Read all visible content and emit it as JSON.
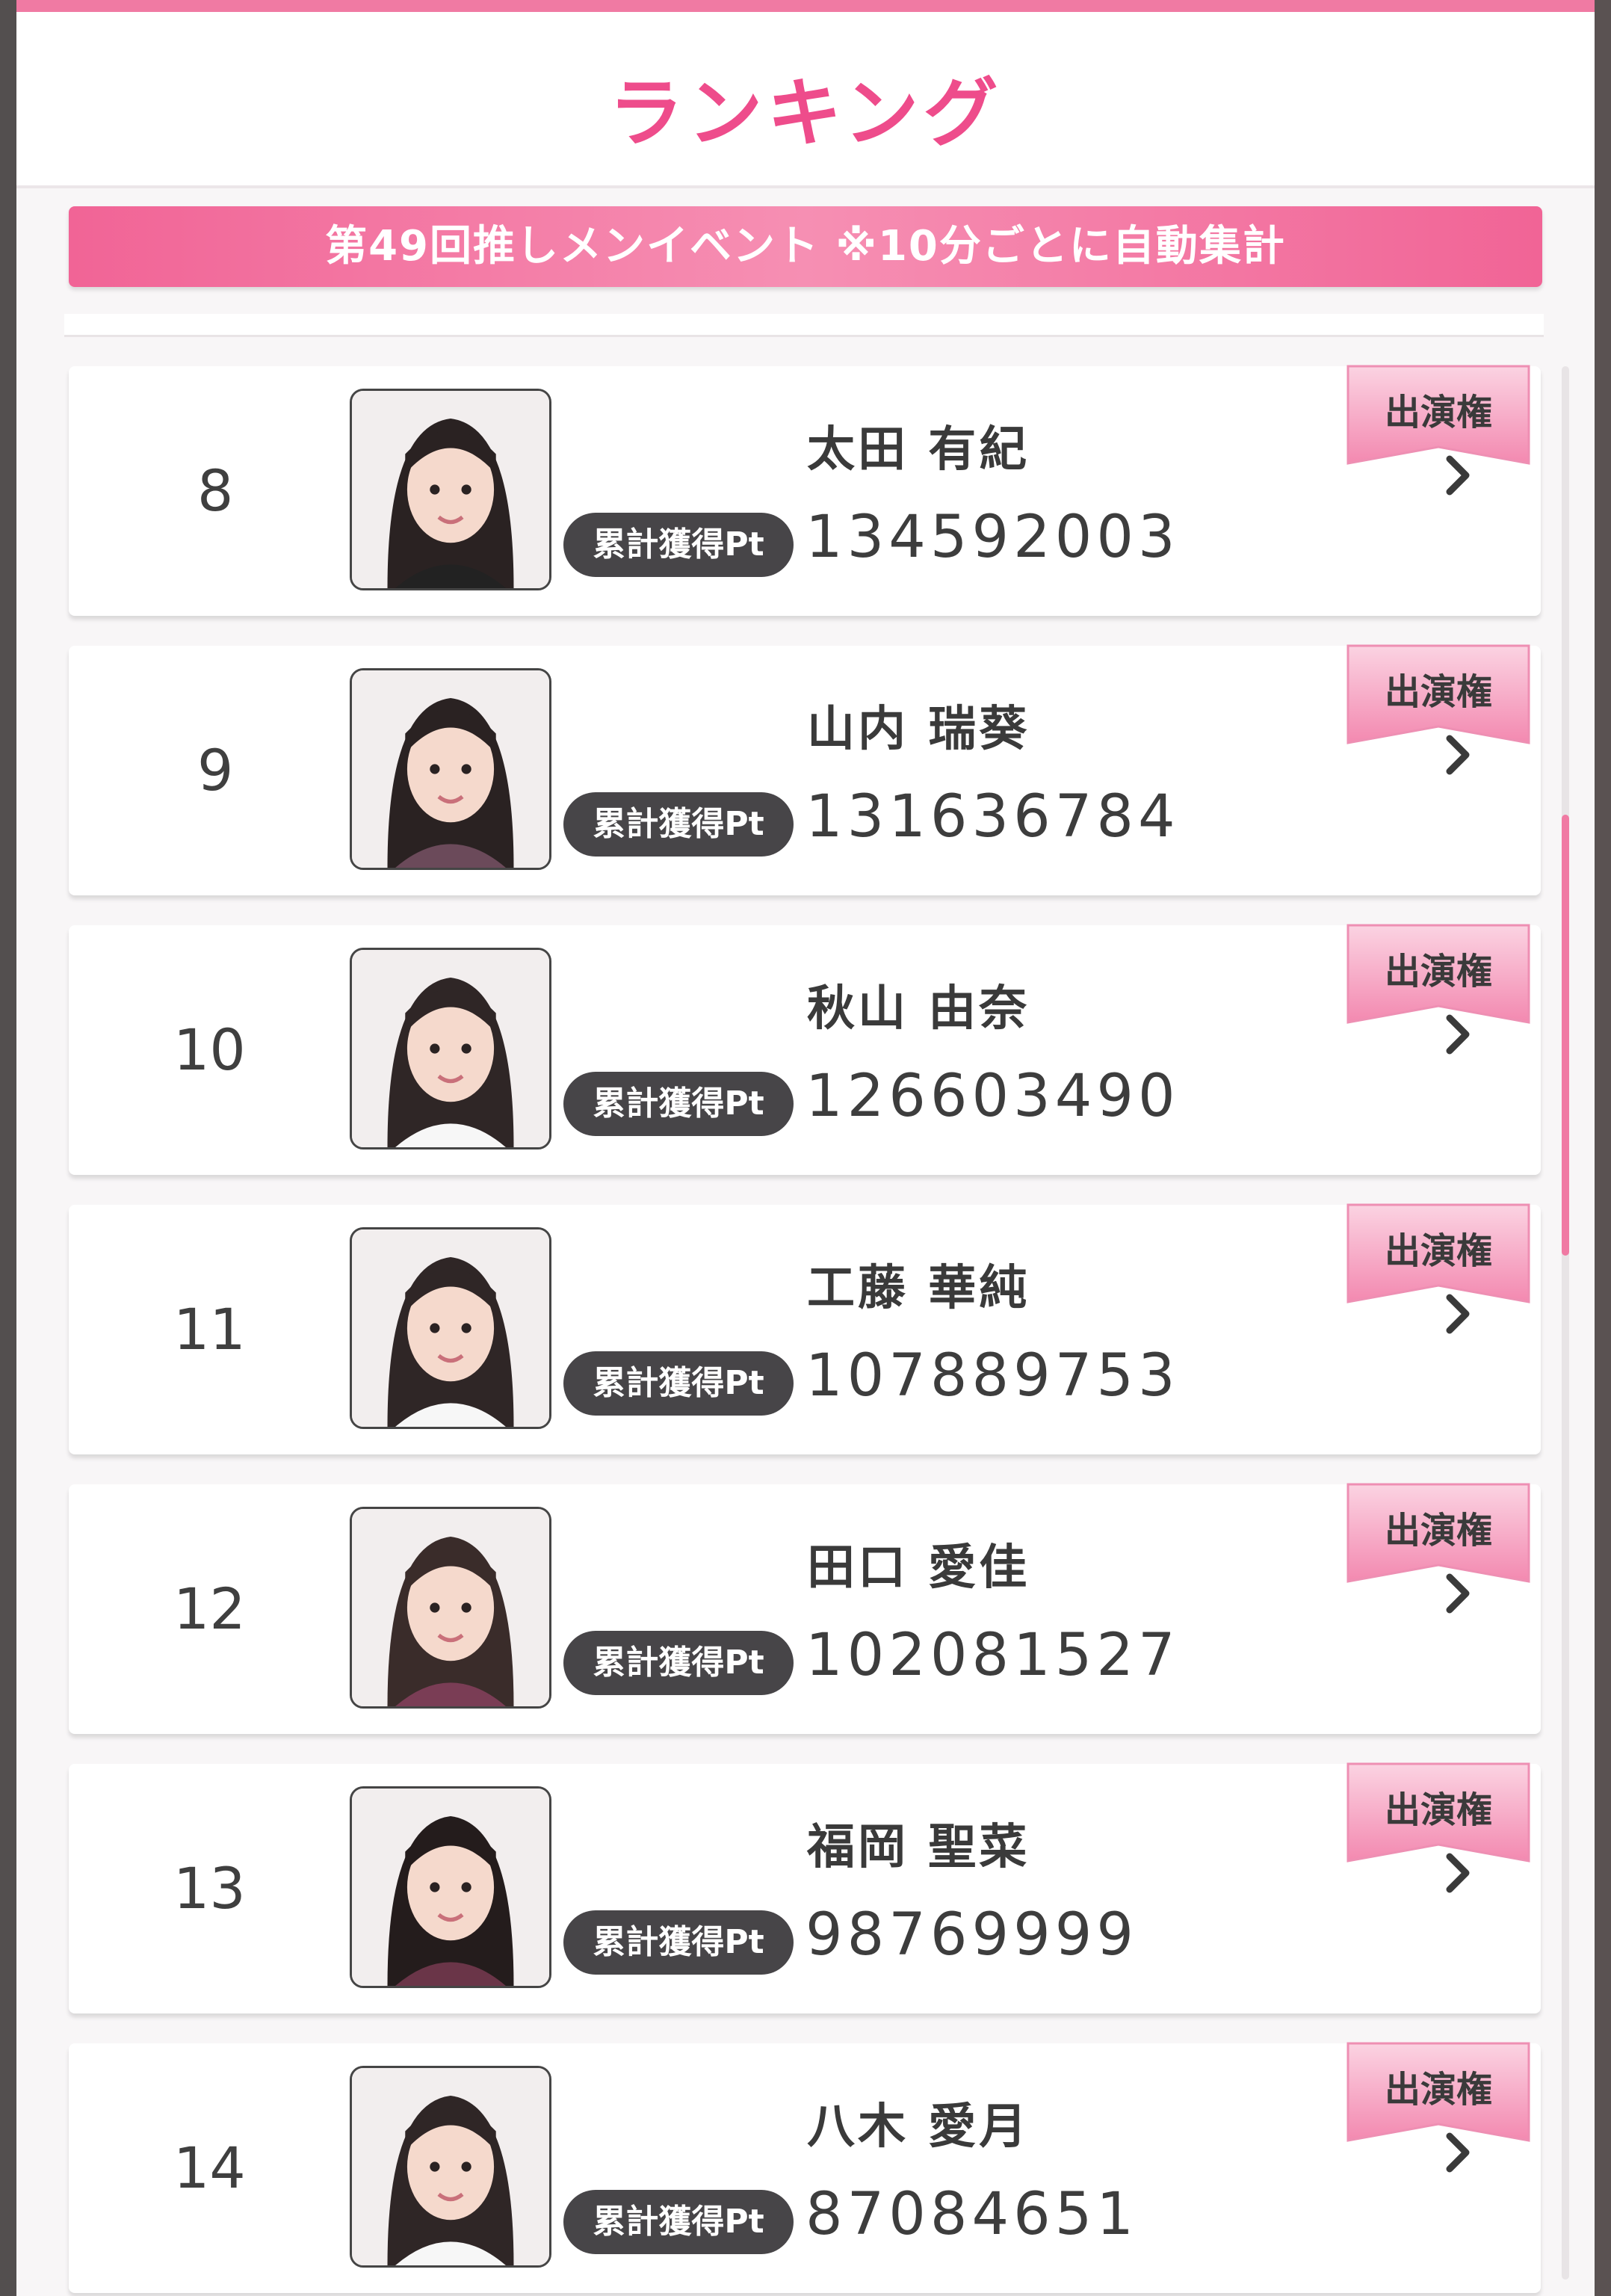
{
  "title": "ランキング",
  "event_banner": "第49回推しメンイベント ※10分ごとに自動集計",
  "colors": {
    "accent": "#ee4c8b",
    "banner": "#f16496",
    "badge": "#474548"
  },
  "ribbon_label": "出演権",
  "pt_label": "累計獲得Pt",
  "rows": [
    {
      "rank": "8",
      "name": "太田 有紀",
      "points": "134592003"
    },
    {
      "rank": "9",
      "name": "山内 瑞葵",
      "points": "131636784"
    },
    {
      "rank": "10",
      "name": "秋山 由奈",
      "points": "126603490"
    },
    {
      "rank": "11",
      "name": "工藤 華純",
      "points": "107889753"
    },
    {
      "rank": "12",
      "name": "田口 愛佳",
      "points": "102081527"
    },
    {
      "rank": "13",
      "name": "福岡 聖菜",
      "points": "98769999"
    },
    {
      "rank": "14",
      "name": "八木 愛月",
      "points": "87084651"
    }
  ],
  "icons": {
    "chevron": "chevron-right-icon",
    "ribbon": "ribbon-badge-icon",
    "photo": "member-photo"
  }
}
